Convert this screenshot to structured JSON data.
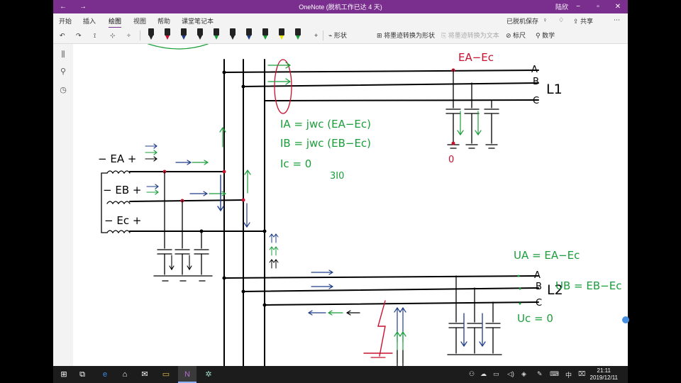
{
  "window": {
    "title": "OneNote (脱机工作已达 4 天)",
    "user": "陆欣",
    "titlebar_color": "#7a2f8f"
  },
  "menu": {
    "tabs": [
      "开始",
      "插入",
      "绘图",
      "视图",
      "帮助",
      "课堂笔记本"
    ],
    "active_tab": "绘图",
    "status": "已脱机保存",
    "share": "共享"
  },
  "toolbar": {
    "shapes": "形状",
    "ink_to_shape": "将墨迹转换为形状",
    "ink_to_text": "将墨迹转换为文本",
    "ruler": "标尺",
    "math": "数学",
    "pen_colors": [
      "#222222",
      "#c8102e",
      "#1f3c88",
      "#222222",
      "#1a9e3a",
      "#222222",
      "#1f3c88",
      "#1a9e3a",
      "#e8e800",
      "#1a9e3a"
    ]
  },
  "ink": {
    "ea_ec_top": "EA−Ec",
    "label_a": "A",
    "label_b": "B",
    "label_c": "C",
    "label_l1": "L1",
    "label_l2": "L2",
    "eq_ia": "IA = jwc (EA−Ec)",
    "eq_ib": "IB = jwc (EB−Ec)",
    "eq_ic": "Ic = 0",
    "eq_3i0": "3I0",
    "src_a": "− EA +",
    "src_b": "− EB +",
    "src_c": "− Ec +",
    "zero": "0",
    "ua": "UA = EA−Ec",
    "ub": "UB = EB−Ec",
    "uc": "Uc = 0"
  },
  "taskbar": {
    "input_method": "中",
    "time": "21:11",
    "date": "2019/12/11"
  }
}
